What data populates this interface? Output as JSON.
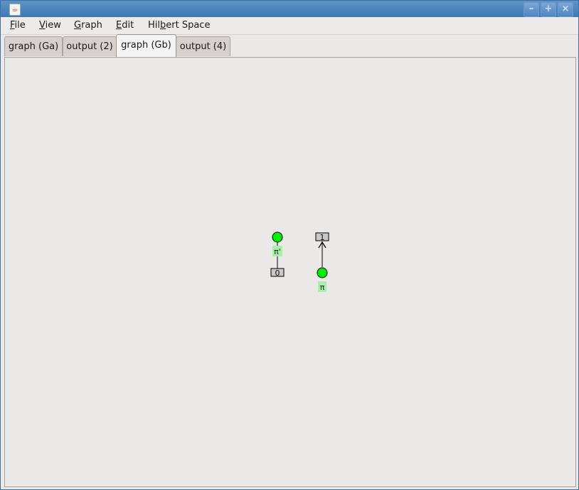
{
  "titlebar": {
    "icon": "java-cup-icon",
    "minimize_glyph": "–",
    "maximize_glyph": "+",
    "close_glyph": "×"
  },
  "menu": {
    "items": [
      {
        "label": "File",
        "mnemonic": "F",
        "rest": "ile"
      },
      {
        "label": "View",
        "mnemonic": "V",
        "rest": "iew"
      },
      {
        "label": "Graph",
        "mnemonic": "G",
        "rest": "raph"
      },
      {
        "label": "Edit",
        "mnemonic": "E",
        "rest": "dit"
      },
      {
        "label": "Hilbert Space",
        "pre": "Hil",
        "mnemonic": "b",
        "rest": "ert Space"
      }
    ]
  },
  "tabs": [
    {
      "label": "graph (Ga)",
      "selected": false
    },
    {
      "label": "output (2)",
      "selected": false
    },
    {
      "label": "graph (Gb)",
      "selected": true
    },
    {
      "label": "output (4)",
      "selected": false
    }
  ],
  "graph": {
    "node_color": "#00ee00",
    "label_bg_color": "#a8f0a8",
    "boundary_color": "#c8c8c8",
    "nodes": [
      {
        "name": "spider-a",
        "label": "π'"
      },
      {
        "name": "spider-b",
        "label": "π"
      }
    ],
    "boundaries": [
      {
        "name": "boundary-0",
        "label": "0"
      },
      {
        "name": "boundary-1",
        "label": "1"
      }
    ],
    "edges": [
      {
        "from": "spider-a",
        "to": "boundary-0",
        "directed": false
      },
      {
        "from": "spider-b",
        "to": "boundary-1",
        "directed": true
      }
    ]
  }
}
